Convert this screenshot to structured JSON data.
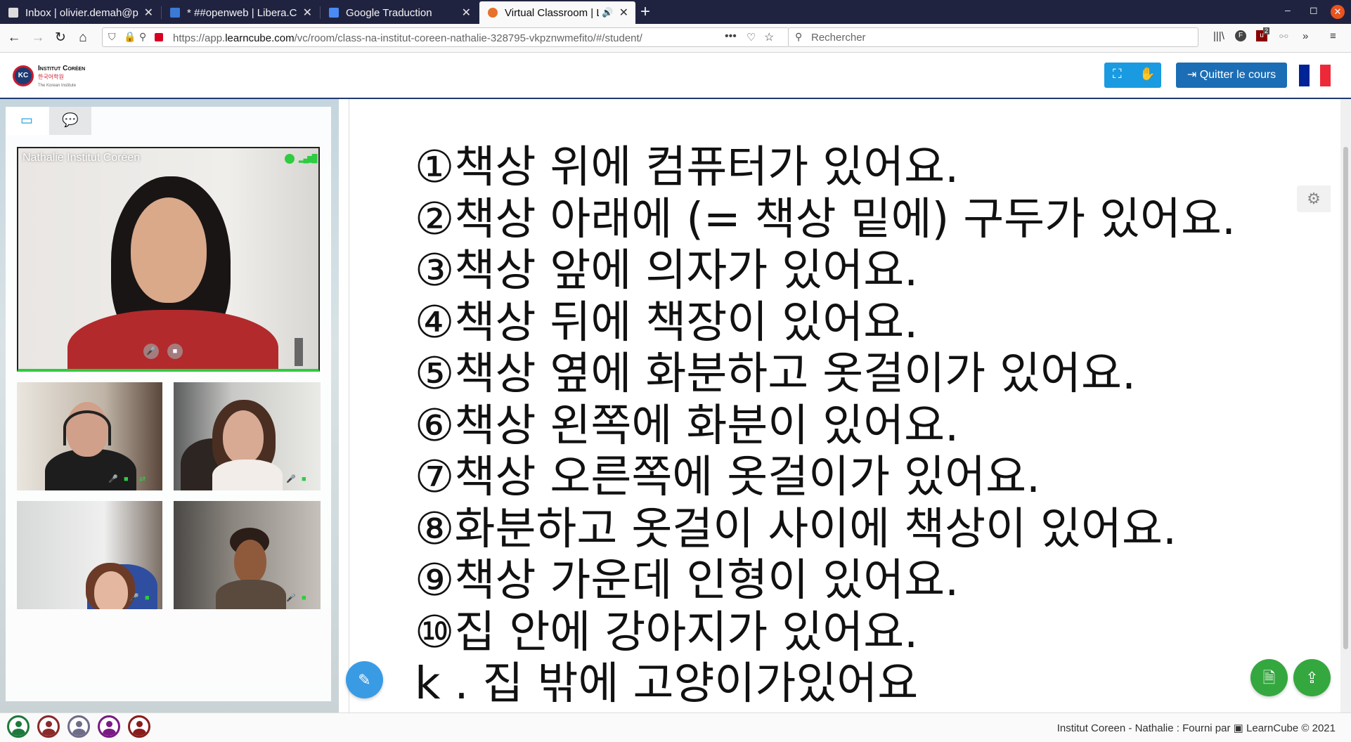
{
  "browser": {
    "tabs": [
      {
        "title": "Inbox | olivier.demah@pr",
        "active": false
      },
      {
        "title": "* ##openweb | Libera.Ch",
        "active": false
      },
      {
        "title": "Google Traduction",
        "active": false
      },
      {
        "title": "Virtual Classroom | Le",
        "active": true
      }
    ],
    "url_prefix": "https://app.",
    "url_domain": "learncube.com",
    "url_path": "/vc/room/class-na-institut-coreen-nathalie-328795-vkpznwmefito/#/student/",
    "search_placeholder": "Rechercher",
    "addon_badge": "2"
  },
  "header": {
    "logo_line1": "Institut Coréen",
    "logo_line2": "한국어학원",
    "logo_line3": "The Korean Institute",
    "quit_label": "Quitter le cours",
    "accent_color": "#1a9ae0",
    "quit_color": "#1b6db5"
  },
  "sidebar": {
    "main_video_name": "Nathalie Institut Coréen"
  },
  "slide": {
    "lines": [
      "①책상 위에 컴퓨터가 있어요.",
      "②책상 아래에 (= 책상 밑에) 구두가 있어요.",
      "③책상 앞에 의자가 있어요.",
      "④책상 뒤에 책장이 있어요.",
      "⑤책상 옆에 화분하고 옷걸이가 있어요.",
      "⑥책상 왼쪽에 화분이 있어요.",
      "⑦책상 오른쪽에 옷걸이가 있어요.",
      "⑧화분하고  옷걸이 사이에 책상이 있어요.",
      "⑨책상 가운데 인형이 있어요.",
      "⑩집 안에 강아지가 있어요.",
      "k . 집 밖에 고양이가있어요"
    ]
  },
  "footer": {
    "text": "Institut Coreen - Nathalie : Fourni par",
    "brand": "LearnCube © 2021"
  }
}
